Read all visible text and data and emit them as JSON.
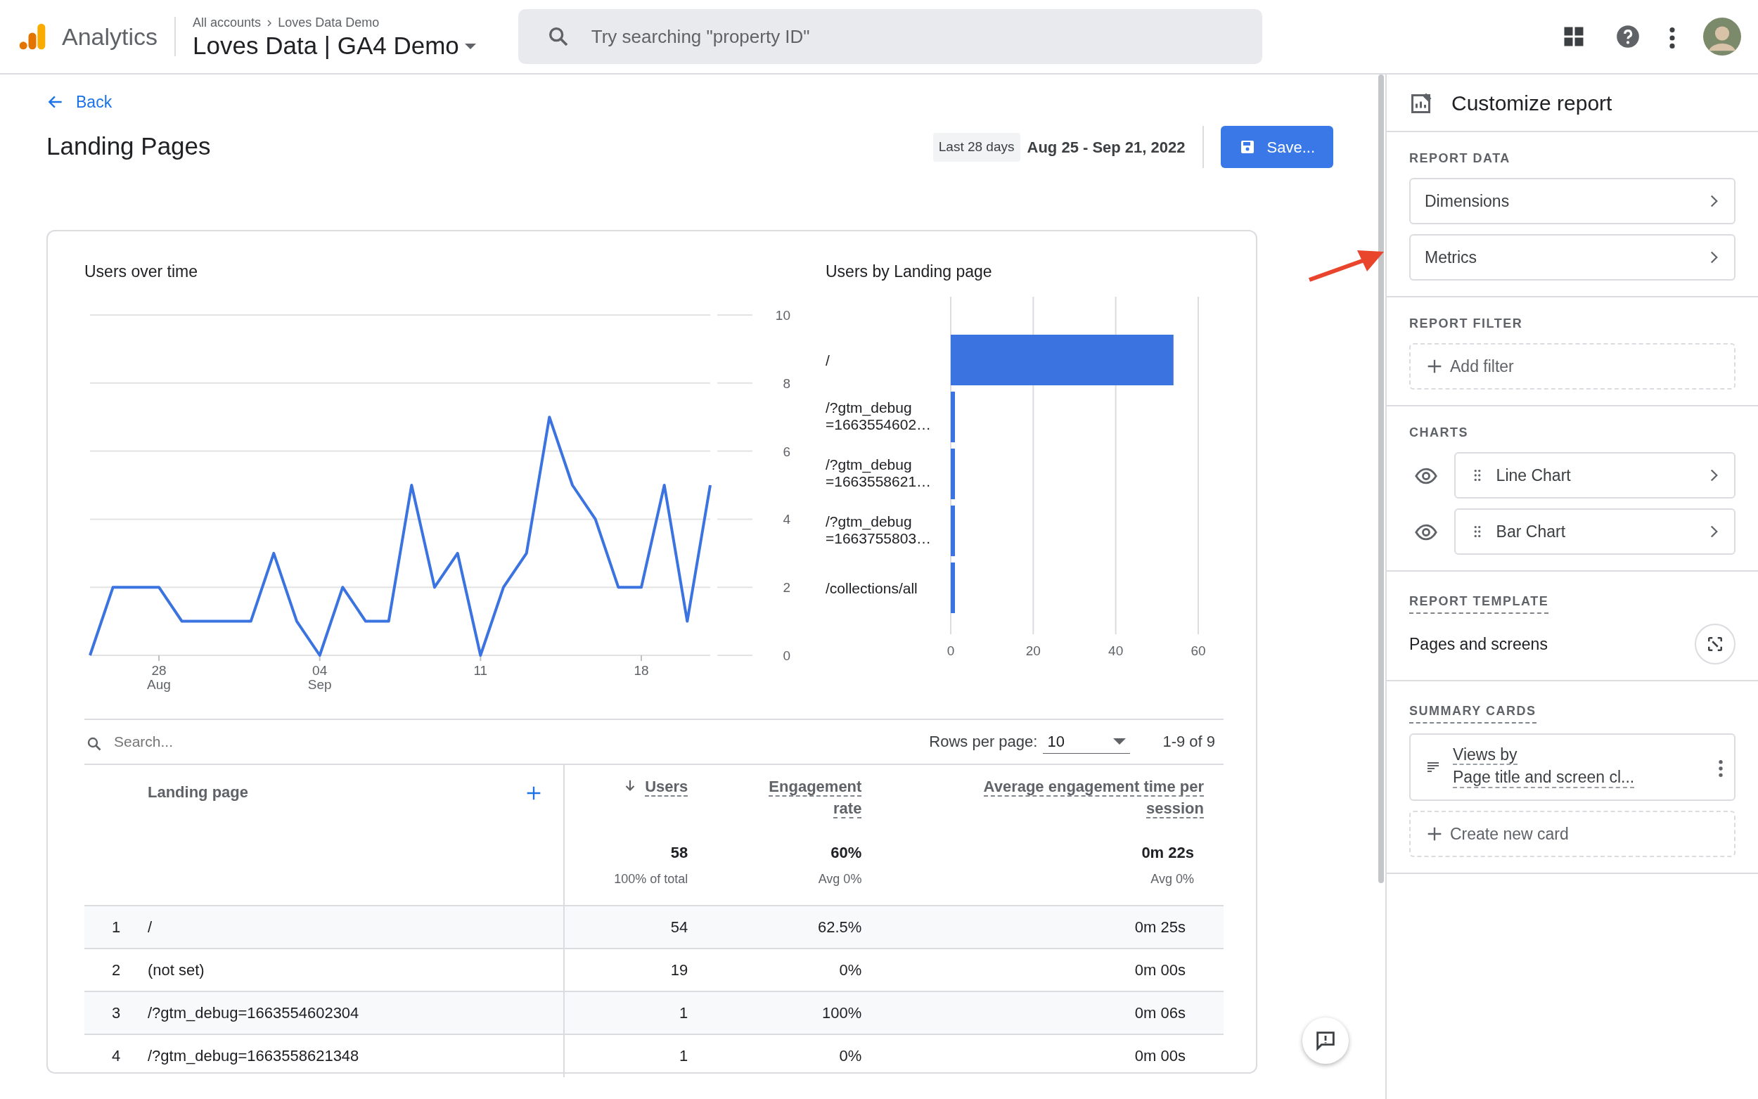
{
  "header": {
    "product": "Analytics",
    "breadcrumb": [
      "All accounts",
      "Loves Data Demo"
    ],
    "property": "Loves Data | GA4 Demo",
    "search": {
      "placeholder": "Try searching \"property ID\""
    }
  },
  "report": {
    "back": "Back",
    "title": "Landing Pages",
    "date_chip": "Last 28 days",
    "date_range": "Aug 25 - Sep 21, 2022",
    "save": "Save..."
  },
  "charts": [
    {
      "chart_data": {
        "type": "line",
        "title": "Users over time",
        "categories": [
          null,
          null,
          null,
          "28 Aug",
          null,
          null,
          null,
          null,
          null,
          null,
          "04 Sep",
          null,
          null,
          null,
          null,
          null,
          null,
          "11",
          null,
          null,
          null,
          null,
          null,
          null,
          "18",
          null,
          null,
          null
        ],
        "ylim": [
          0,
          10
        ],
        "yticks": [
          0,
          2,
          4,
          6,
          8,
          10
        ],
        "grid": true,
        "series": [
          {
            "color": "#3b73e0",
            "values": [
              0,
              2,
              2,
              2,
              1,
              1,
              1,
              1,
              3,
              1,
              0,
              2,
              1,
              1,
              5,
              2,
              3,
              0,
              2,
              3,
              7,
              5,
              4,
              2,
              2,
              5,
              1,
              5
            ]
          }
        ]
      }
    },
    {
      "chart_data": {
        "type": "bar",
        "orientation": "horizontal",
        "title": "Users by Landing page",
        "categories": [
          "/",
          "/?gtm_debug =1663554602…",
          "/?gtm_debug =1663558621…",
          "/?gtm_debug =1663755803…",
          "/collections/all"
        ],
        "xlim": [
          0,
          60
        ],
        "xticks": [
          0,
          20,
          40,
          60
        ],
        "series": [
          {
            "color": "#3b73e0",
            "values": [
              54,
              1,
              1,
              1,
              1
            ]
          }
        ]
      }
    }
  ],
  "table": {
    "search": {
      "placeholder": "Search..."
    },
    "rows_per_page_label": "Rows per page:",
    "rows_per_page": "10",
    "range": "1-9 of 9",
    "columns": [
      {
        "label": "Landing page",
        "sorted": false
      },
      {
        "label": "Users",
        "sorted": true
      },
      {
        "label": "Engagement rate",
        "sorted": false
      },
      {
        "label": "Average engagement time per session",
        "sorted": false
      }
    ],
    "totals": [
      {
        "value": "58",
        "note": "100% of total"
      },
      {
        "value": "60%",
        "note": "Avg 0%"
      },
      {
        "value": "0m 22s",
        "note": "Avg 0%"
      }
    ],
    "rows": [
      {
        "index": "1",
        "page": "/",
        "users": "54",
        "engagement_rate": "62.5%",
        "avg_time": "0m 25s"
      },
      {
        "index": "2",
        "page": "(not set)",
        "users": "19",
        "engagement_rate": "0%",
        "avg_time": "0m 00s"
      },
      {
        "index": "3",
        "page": "/?gtm_debug=1663554602304",
        "users": "1",
        "engagement_rate": "100%",
        "avg_time": "0m 06s"
      },
      {
        "index": "4",
        "page": "/?gtm_debug=1663558621348",
        "users": "1",
        "engagement_rate": "0%",
        "avg_time": "0m 00s"
      }
    ]
  },
  "panel": {
    "title": "Customize report",
    "report_data": {
      "heading": "REPORT DATA",
      "items": [
        "Dimensions",
        "Metrics"
      ]
    },
    "report_filter": {
      "heading": "REPORT FILTER",
      "add": "Add filter"
    },
    "charts": {
      "heading": "CHARTS",
      "items": [
        {
          "label": "Line Chart",
          "visible": true
        },
        {
          "label": "Bar Chart",
          "visible": true
        }
      ]
    },
    "template": {
      "heading": "REPORT TEMPLATE",
      "name": "Pages and screens"
    },
    "summary_cards": {
      "heading": "SUMMARY CARDS",
      "cards": [
        {
          "line1": "Views by",
          "line2": "Page title and screen cl..."
        }
      ],
      "create": "Create new card"
    }
  }
}
